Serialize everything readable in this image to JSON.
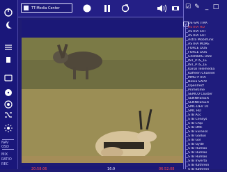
{
  "app": {
    "title": "TT-Media Center"
  },
  "left_panel": {
    "labels": [
      "NAV",
      "OSD",
      "MIX",
      "RATIO",
      "REC"
    ]
  },
  "status": {
    "left": "20:58:06",
    "middle": "16:9",
    "right": "06:52:08"
  },
  "channel_list": {
    "root": "DE-SAT/TRA",
    "items": [
      "ASTRA HD",
      "ASTRA SAT",
      "ASTRA SAT",
      "Astra Mobilfunk",
      "ASTRA MORE",
      "FORCE DOS",
      "FORCE DOS",
      "GRUNDIG DVB",
      "INT_PTS_1E",
      "INT_PTS_1E",
      "Kanal Telemedia",
      "Kaffeen Channel",
      "MMO PTHA",
      "Nokia SAP9",
      "OpenIrecf",
      "Primetime",
      "SEMCO Cluster",
      "SENNHEISER",
      "SENNHEISER",
      "SMC-DEV 10",
      "SMC HD",
      "STB Acc",
      "STB Censys",
      "STB Chip",
      "STB DMF",
      "STB Eviness",
      "STB Gaduo",
      "STB Gol",
      "STB Gyde",
      "STB Humax",
      "STB Humax",
      "STB Humax",
      "STB Inverto",
      "STB Kathrein",
      "STB Kathrein"
    ],
    "selected_index": 0
  },
  "colors": {
    "background": "#1e1b74",
    "accent_red": "#ff4a4a",
    "panel": "#1f1c7d"
  }
}
